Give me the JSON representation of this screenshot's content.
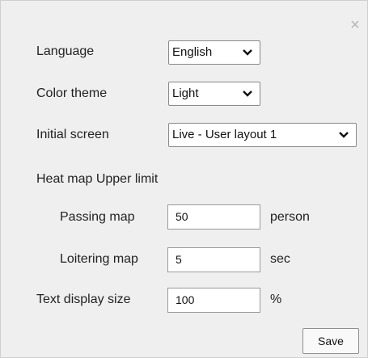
{
  "dialog": {
    "close_icon": "×",
    "language": {
      "label": "Language",
      "value": "English"
    },
    "color_theme": {
      "label": "Color theme",
      "value": "Light"
    },
    "initial_screen": {
      "label": "Initial screen",
      "value": "Live - User layout 1"
    },
    "heat_map": {
      "title": "Heat map Upper limit",
      "passing": {
        "label": "Passing map",
        "value": "50",
        "unit": "person"
      },
      "loitering": {
        "label": "Loitering map",
        "value": "5",
        "unit": "sec"
      }
    },
    "text_size": {
      "label": "Text display size",
      "value": "100",
      "unit": "%"
    },
    "save_label": "Save"
  }
}
